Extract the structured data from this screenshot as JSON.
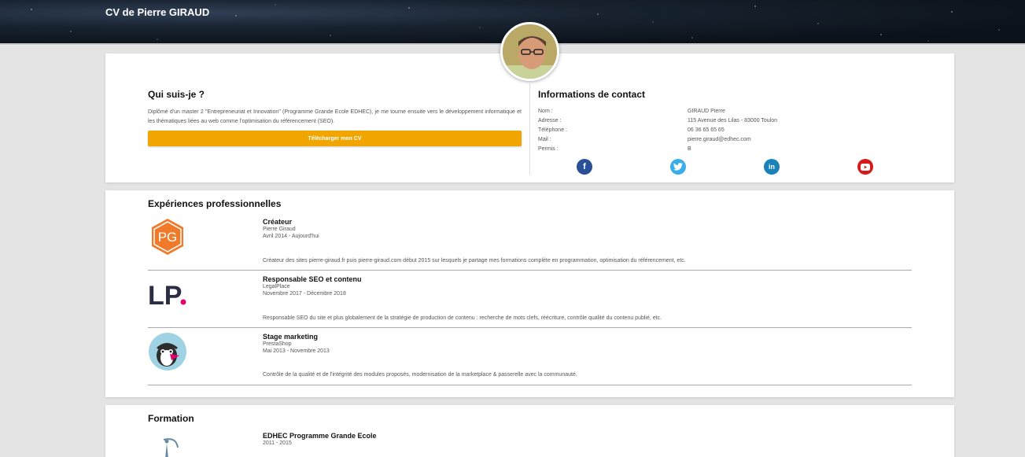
{
  "header": {
    "title": "CV de Pierre GIRAUD"
  },
  "about": {
    "title": "Qui suis-je ?",
    "text": "Diplômé d'un master 2 \"Entrepreneuriat et Innovation\" (Programme Grande Ecole EDHEC), je me tourne ensuite vers le développement informatique et les thématiques liées au web comme l'optimisation du référencement (SEO).",
    "button": "Télécharger mon CV"
  },
  "contact": {
    "title": "Informations de contact",
    "rows": [
      {
        "label": "Nom :",
        "value": "GIRAUD Pierre"
      },
      {
        "label": "Adresse :",
        "value": "115 Avenue des Lilas - 83000 Toulon"
      },
      {
        "label": "Téléphone :",
        "value": "06 36 65 65 65"
      },
      {
        "label": "Mail :",
        "value": "pierre.giraud@edhec.com"
      },
      {
        "label": "Permis :",
        "value": "B"
      }
    ],
    "social": [
      {
        "name": "facebook-icon",
        "glyph": "f",
        "color": "#2b4f96"
      },
      {
        "name": "twitter-icon",
        "glyph": "t",
        "color": "#3aaee8"
      },
      {
        "name": "linkedin-icon",
        "glyph": "in",
        "color": "#1a82b8"
      },
      {
        "name": "youtube-icon",
        "glyph": "▶",
        "color": "#d61a1a"
      }
    ]
  },
  "experiences": {
    "title": "Expériences professionnelles",
    "items": [
      {
        "title": "Créateur",
        "company": "Pierre Giraud",
        "dates": "Avril 2014 - Aujourd'hui",
        "desc": "Créateur des sites pierre-giraud.fr puis pierre-giraud.com début 2015 sur lesquels je partage mes formations complète en programmation, optimisation du référencement, etc.",
        "logo": "PG"
      },
      {
        "title": "Responsable SEO et contenu",
        "company": "LegalPlace",
        "dates": "Novembre 2017 - Décembre 2018",
        "desc": "Responsable SEO du site et plus globalement de la stratégie de production de contenu : recherche de mots clefs, réécriture, contrôle qualité du contenu publié, etc.",
        "logo": "LP"
      },
      {
        "title": "Stage marketing",
        "company": "PrestaShop",
        "dates": "Mai 2013 - Novembre 2013",
        "desc": "Contrôle de la qualité et de l'intégrité des modules proposés, modernisation de la marketplace & passerelle avec la communauté.",
        "logo": ""
      }
    ]
  },
  "formation": {
    "title": "Formation",
    "items": [
      {
        "title": "EDHEC Programme Grande Ecole",
        "dates": "2011 - 2015"
      }
    ]
  },
  "colors": {
    "accent": "#f0a500",
    "pg_orange": "#f07a2a",
    "lp_pink": "#e5006e"
  }
}
